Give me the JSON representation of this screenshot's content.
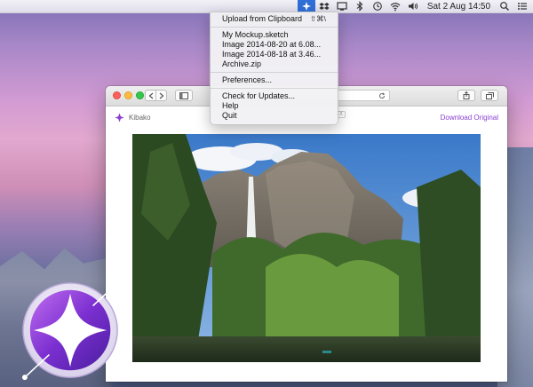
{
  "menubar": {
    "items": [
      {
        "name": "kibako-menubar-icon",
        "icon": "kibako-icon",
        "active": true
      },
      {
        "name": "dropbox-icon",
        "icon": "dropbox-icon"
      },
      {
        "name": "display-icon",
        "icon": "display-icon"
      },
      {
        "name": "bluetooth-icon",
        "icon": "bluetooth-icon"
      },
      {
        "name": "time-machine-icon",
        "icon": "time-machine-icon"
      },
      {
        "name": "wifi-icon",
        "icon": "wifi-icon"
      },
      {
        "name": "volume-icon",
        "icon": "volume-icon"
      }
    ],
    "clock": "Sat 2 Aug  14:50"
  },
  "menu": {
    "upload_label": "Upload from Clipboard",
    "upload_shortcut": "⇧⌘\\",
    "recent": [
      {
        "label": "My Mockup.sketch"
      },
      {
        "label": "Image 2014-08-20 at 6.08..."
      },
      {
        "label": "Image 2014-08-18 at 3.46..."
      },
      {
        "label": "Archive.zip"
      }
    ],
    "preferences_label": "Preferences...",
    "updates_label": "Check for Updates...",
    "help_label": "Help",
    "quit_label": "Quit"
  },
  "page": {
    "brand_name": "Kibako",
    "download_label": "Download Original",
    "ghost_tag": "EX"
  },
  "colors": {
    "accent": "#8a3fd1",
    "menu_highlight": "#2f6fd6"
  }
}
